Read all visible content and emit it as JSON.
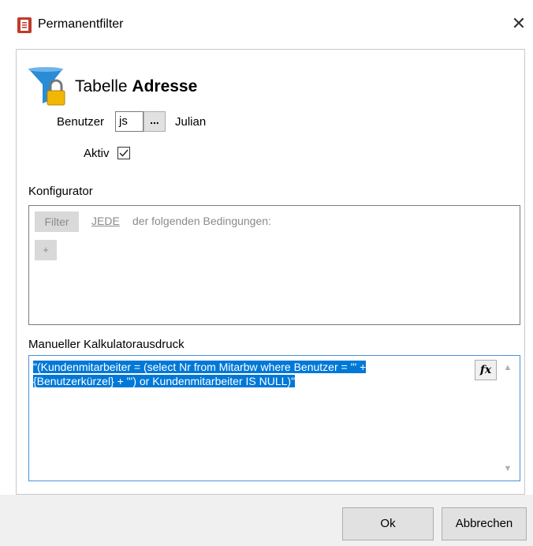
{
  "window": {
    "title": "Permanentfilter",
    "close_glyph": "✕"
  },
  "header": {
    "table_prefix": "Tabelle",
    "table_name": "Adresse"
  },
  "benutzer": {
    "label": "Benutzer",
    "value": "js",
    "browse_label": "...",
    "name": "Julian"
  },
  "aktiv": {
    "label": "Aktiv",
    "checked": true
  },
  "konfigurator": {
    "label": "Konfigurator",
    "filter_button": "Filter",
    "jede_link": "JEDE",
    "conditions_text": "der folgenden Bedingungen:",
    "add_button": "+"
  },
  "kalkulator": {
    "label": "Manueller Kalkulatorausdruck",
    "expression_line1": "\"(Kundenmitarbeiter = (select Nr from Mitarbw where Benutzer = '\" +",
    "expression_line2": "{Benutzerkürzel} + \"') or Kundenmitarbeiter IS NULL)\"",
    "fx_button": "fx"
  },
  "buttons": {
    "ok": "Ok",
    "cancel": "Abbrechen"
  },
  "colors": {
    "selection": "#0078d7",
    "funnel": "#2a8bd6",
    "lock": "#f2b705"
  }
}
